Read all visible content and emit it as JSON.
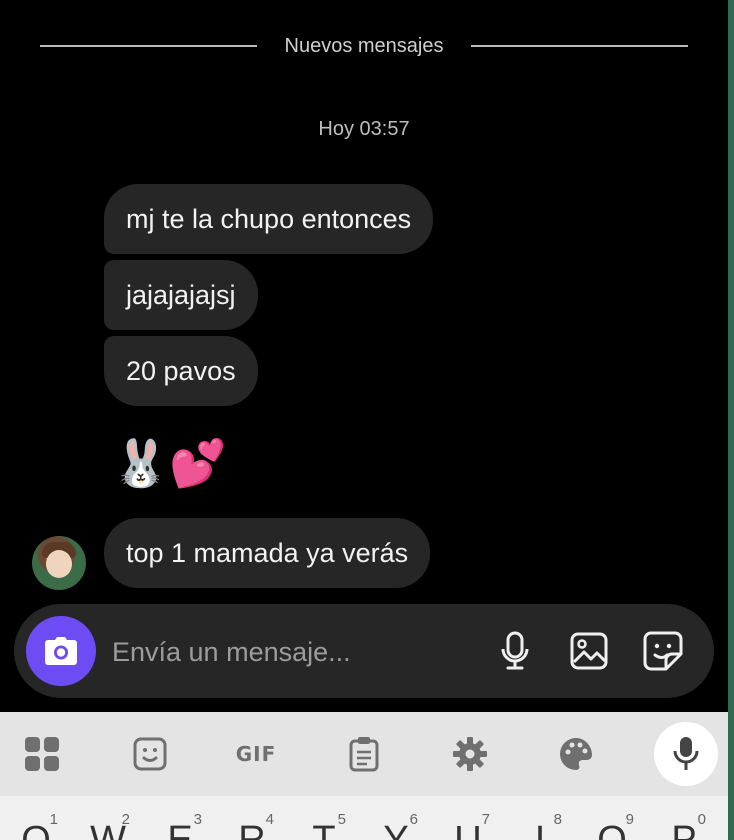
{
  "chat": {
    "divider_label": "Nuevos mensajes",
    "timestamp": "Hoy 03:57",
    "messages": [
      "mj te la chupo entonces",
      "jajajajajsj",
      "20 pavos",
      "top 1 mamada ya verás"
    ],
    "emoji_reaction": "🐰💕"
  },
  "composer": {
    "placeholder": "Envía un mensaje...",
    "accent_color": "#6e4cf4"
  },
  "keyboard": {
    "gif_label": "GIF",
    "keys": [
      {
        "letter": "Q",
        "hint": "1"
      },
      {
        "letter": "W",
        "hint": "2"
      },
      {
        "letter": "E",
        "hint": "3"
      },
      {
        "letter": "R",
        "hint": "4"
      },
      {
        "letter": "T",
        "hint": "5"
      },
      {
        "letter": "Y",
        "hint": "6"
      },
      {
        "letter": "U",
        "hint": "7"
      },
      {
        "letter": "I",
        "hint": "8"
      },
      {
        "letter": "O",
        "hint": "9"
      },
      {
        "letter": "P",
        "hint": "0"
      }
    ]
  }
}
